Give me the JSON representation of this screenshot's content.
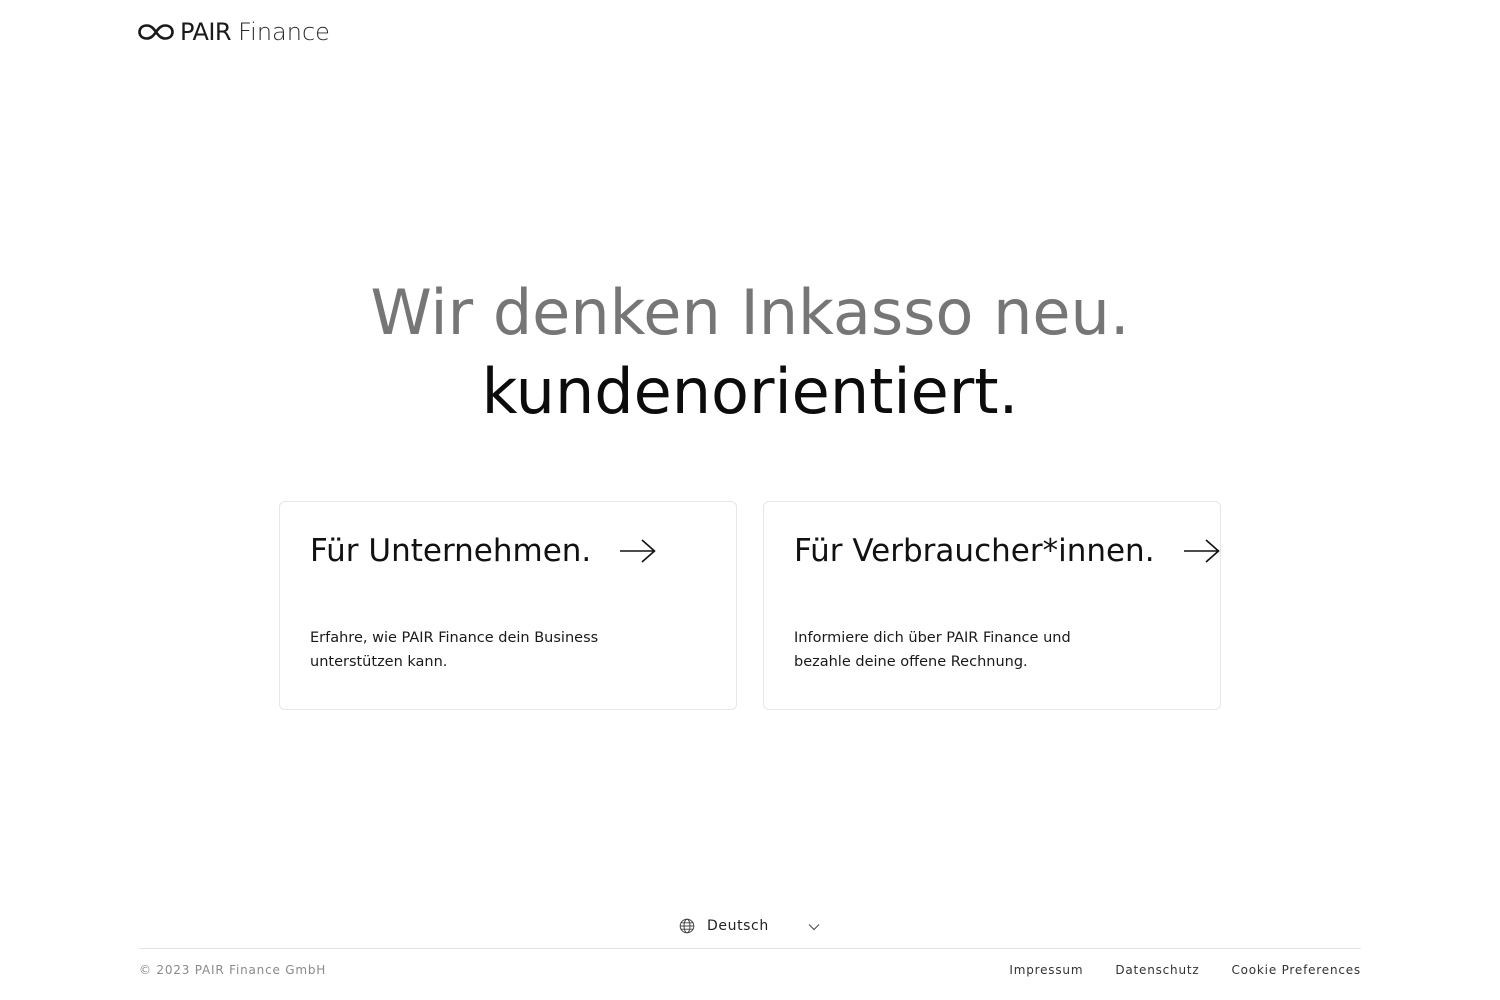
{
  "header": {
    "logo_strong": "PAIR",
    "logo_light": "Finance",
    "logo_icon": "infinity-icon"
  },
  "hero": {
    "line1": "Wir denken Inkasso neu.",
    "line2": "kundenorientiert."
  },
  "cards": [
    {
      "title": "Für Unternehmen.",
      "description": "Erfahre, wie PAIR Finance dein Business unterstützen kann.",
      "icon": "arrow-right-icon"
    },
    {
      "title": "Für Verbraucher*innen.",
      "description": "Informiere dich über PAIR Finance und bezahle deine offene Rechnung.",
      "icon": "arrow-right-icon"
    }
  ],
  "language": {
    "selected": "Deutsch",
    "icon": "globe-icon",
    "dropdown_icon": "chevron-down-icon"
  },
  "footer": {
    "copyright": "© 2023 PAIR Finance GmbH",
    "links": [
      "Impressum",
      "Datenschutz",
      "Cookie Preferences"
    ]
  },
  "colors": {
    "hero_muted": "#767676",
    "text": "#111111",
    "card_border": "#e6e6e6",
    "footer_muted": "#8a8a8a"
  }
}
